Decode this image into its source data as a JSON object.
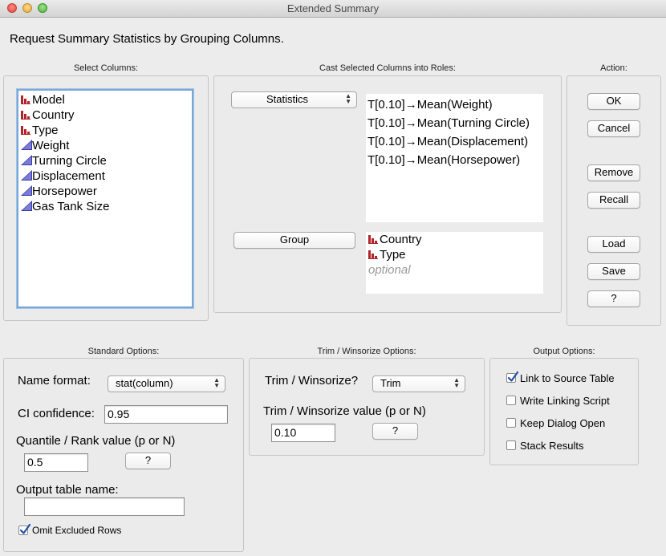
{
  "window": {
    "title": "Extended Summary"
  },
  "heading": "Request Summary Statistics by Grouping Columns.",
  "sections": {
    "select_columns": "Select Columns:",
    "cast_roles": "Cast Selected Columns into Roles:",
    "action": "Action:",
    "standard_options": "Standard Options:",
    "trim_options": "Trim / Winsorize Options:",
    "output_options": "Output Options:"
  },
  "columns": [
    {
      "label": "Model",
      "icon": "nominal-column-icon"
    },
    {
      "label": "Country",
      "icon": "nominal-column-icon"
    },
    {
      "label": "Type",
      "icon": "nominal-column-icon"
    },
    {
      "label": "Weight",
      "icon": "continuous-column-icon"
    },
    {
      "label": "Turning Circle",
      "icon": "continuous-column-icon"
    },
    {
      "label": "Displacement",
      "icon": "continuous-column-icon"
    },
    {
      "label": "Horsepower",
      "icon": "continuous-column-icon"
    },
    {
      "label": "Gas Tank Size",
      "icon": "continuous-column-icon"
    }
  ],
  "roles": {
    "statistics_popup": "Statistics",
    "statistics_items": [
      "T[0.10]→Mean(Weight)",
      "T[0.10]→Mean(Turning Circle)",
      "T[0.10]→Mean(Displacement)",
      "T[0.10]→Mean(Horsepower)"
    ],
    "group_button": "Group",
    "group_items": [
      "Country",
      "Type"
    ],
    "group_placeholder": "optional"
  },
  "actions": {
    "ok": "OK",
    "cancel": "Cancel",
    "remove": "Remove",
    "recall": "Recall",
    "load": "Load",
    "save": "Save",
    "help": "?"
  },
  "standard": {
    "name_format_label": "Name format:",
    "name_format_value": "stat(column)",
    "ci_label": "CI confidence:",
    "ci_value": "0.95",
    "quantile_label": "Quantile / Rank value (p or N)",
    "quantile_value": "0.5",
    "quantile_help": "?",
    "output_name_label": "Output table name:",
    "output_name_value": "",
    "omit_excluded_label": "Omit Excluded Rows",
    "omit_excluded_checked": true
  },
  "trim": {
    "trim_label": "Trim / Winsorize?",
    "trim_value": "Trim",
    "trim_value_label": "Trim / Winsorize value (p or N)",
    "trim_value_input": "0.10",
    "trim_help": "?"
  },
  "output": {
    "link_source": {
      "label": "Link to Source Table",
      "checked": true
    },
    "write_script": {
      "label": "Write Linking Script",
      "checked": false
    },
    "keep_open": {
      "label": "Keep Dialog Open",
      "checked": false
    },
    "stack_results": {
      "label": "Stack Results",
      "checked": false
    }
  },
  "colors": {
    "nominal_icon": "#b0252a",
    "continuous_icon": "#3a3aa8",
    "checkbox_check": "#1f4fa8",
    "focus_ring": "#7aa7d6"
  }
}
